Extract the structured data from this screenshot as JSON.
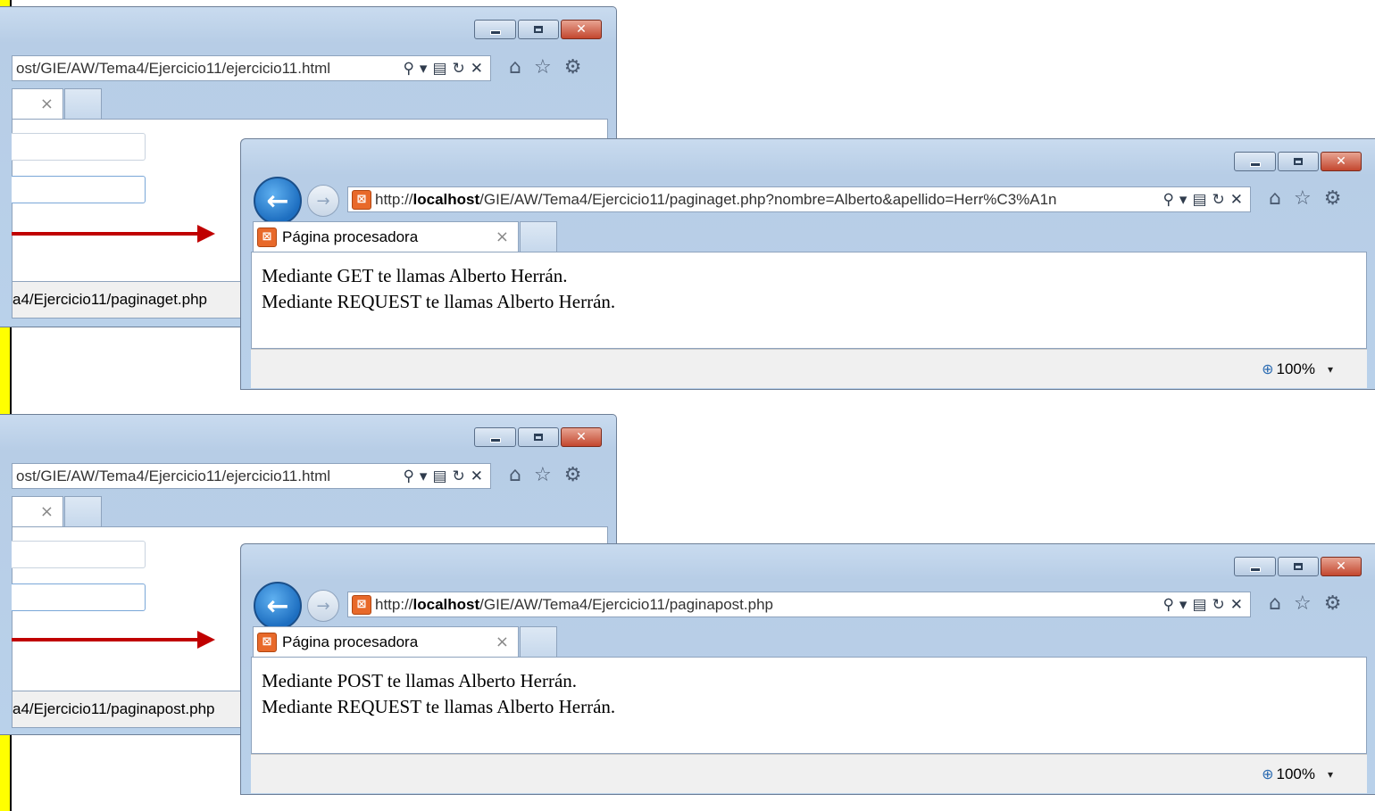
{
  "top": {
    "back_window": {
      "url": "ost/GIE/AW/Tema4/Ejercicio11/ejercicio11.html",
      "status_url": "a4/Ejercicio11/paginaget.php"
    },
    "front_window": {
      "url_prefix": "http://",
      "url_host": "localhost",
      "url_path": "/GIE/AW/Tema4/Ejercicio11/paginaget.php?nombre=Alberto&apellido=Herr%C3%A1n",
      "tab_title": "Página procesadora",
      "lines": [
        "Mediante GET te llamas Alberto Herrán.",
        "Mediante REQUEST te llamas Alberto Herrán."
      ],
      "zoom": "100%"
    }
  },
  "bottom": {
    "back_window": {
      "url": "ost/GIE/AW/Tema4/Ejercicio11/ejercicio11.html",
      "status_url": "a4/Ejercicio11/paginapost.php"
    },
    "front_window": {
      "url_prefix": "http://",
      "url_host": "localhost",
      "url_path": "/GIE/AW/Tema4/Ejercicio11/paginapost.php",
      "tab_title": "Página procesadora",
      "lines": [
        "Mediante POST te llamas Alberto Herrán.",
        "Mediante REQUEST te llamas Alberto Herrán."
      ],
      "zoom": "100%"
    }
  },
  "icons": {
    "search": "⚲",
    "dropdown": "▾",
    "compat": "▤",
    "refresh": "↻",
    "stop": "✕",
    "home": "⌂",
    "favorites": "☆",
    "tools": "⚙",
    "close_tab": "×",
    "back": "←",
    "forward": "→",
    "zoom": "⊕"
  },
  "colors": {
    "sidebar": "#ffff00",
    "arrow": "#c00000",
    "chrome": "#b9d1ea"
  }
}
